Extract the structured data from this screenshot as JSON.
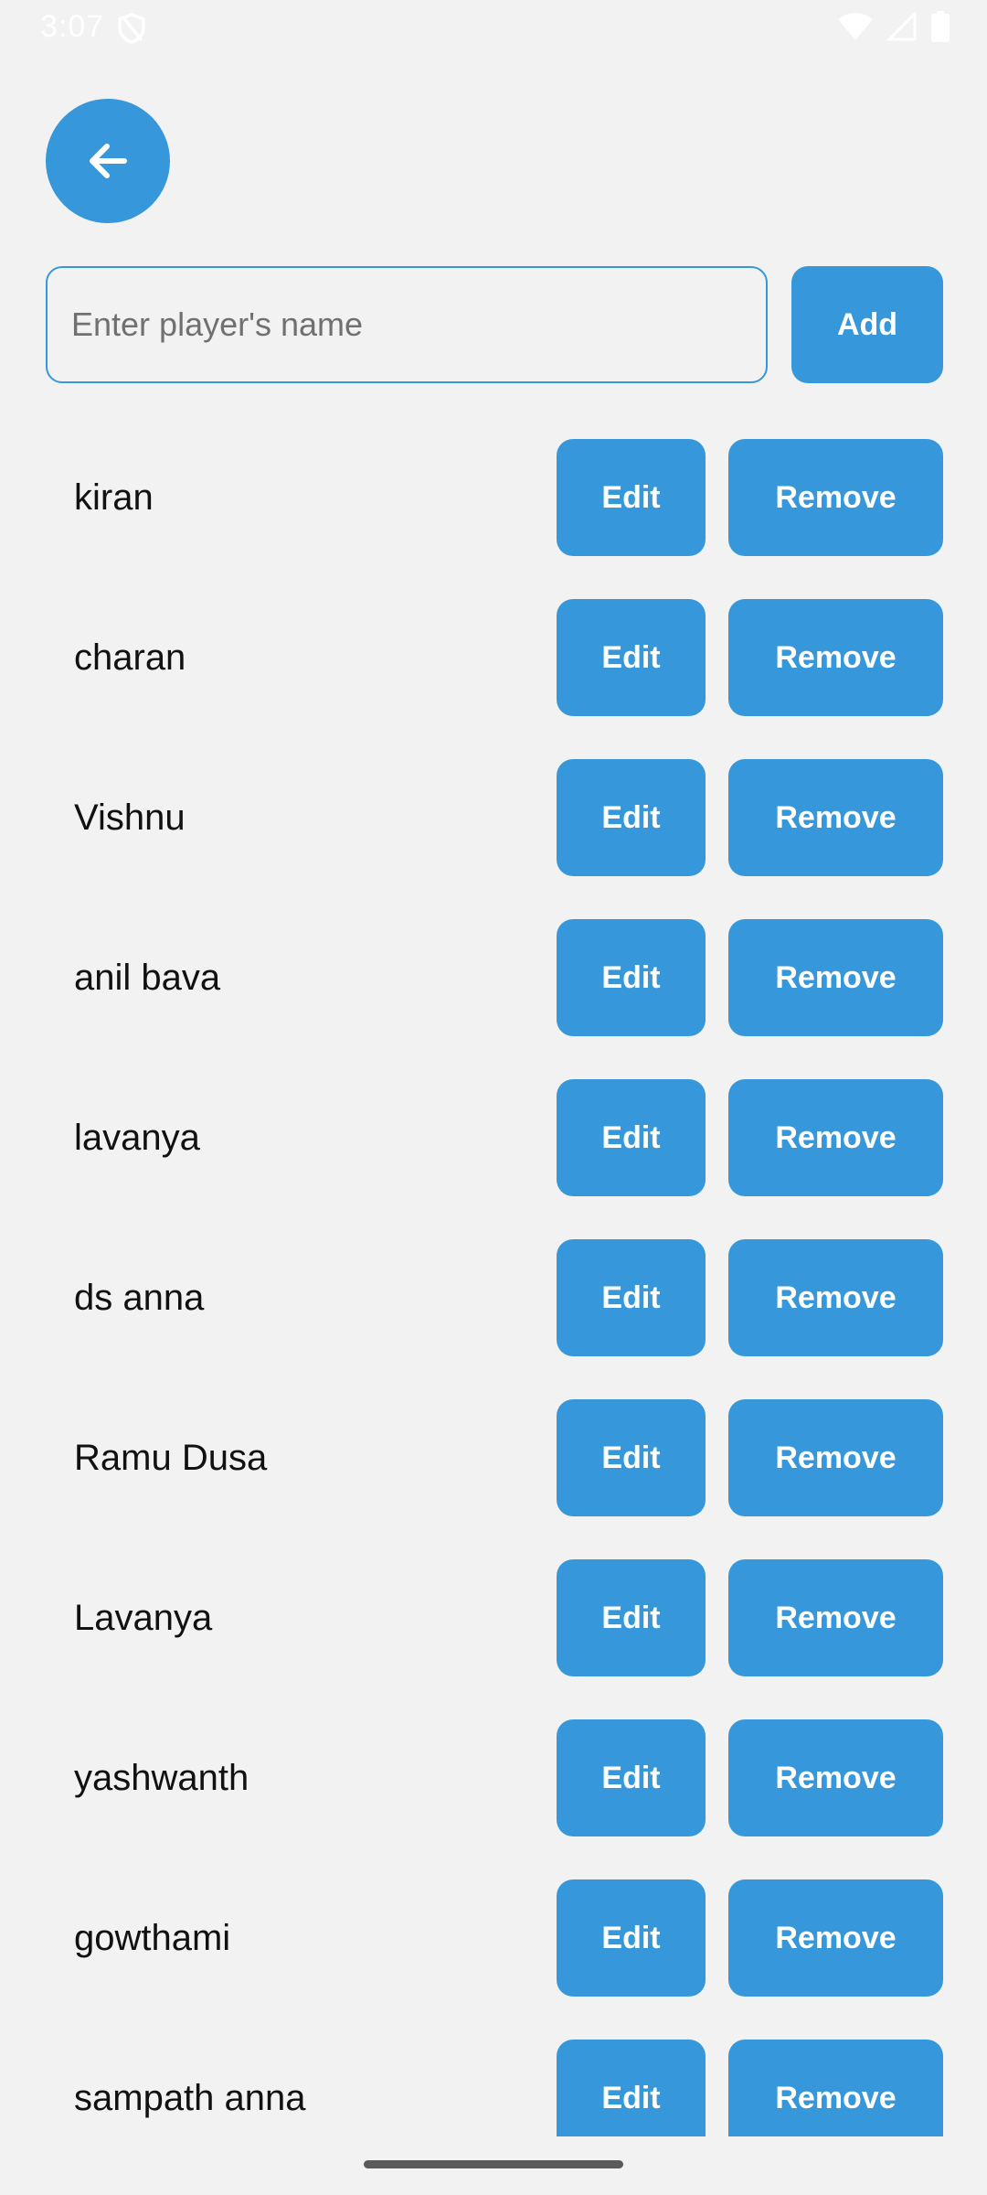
{
  "status_bar": {
    "time": "3:07",
    "icons": [
      "shield-icon",
      "wifi-icon",
      "cellular-icon",
      "battery-icon"
    ]
  },
  "header": {
    "back_icon": "arrow-left-icon"
  },
  "add_player": {
    "value": "",
    "placeholder": "Enter player's name",
    "add_label": "Add"
  },
  "players": [
    {
      "name": "kiran",
      "edit_label": "Edit",
      "remove_label": "Remove"
    },
    {
      "name": "charan",
      "edit_label": "Edit",
      "remove_label": "Remove"
    },
    {
      "name": "Vishnu",
      "edit_label": "Edit",
      "remove_label": "Remove"
    },
    {
      "name": "anil bava",
      "edit_label": "Edit",
      "remove_label": "Remove"
    },
    {
      "name": "lavanya",
      "edit_label": "Edit",
      "remove_label": "Remove"
    },
    {
      "name": "ds anna",
      "edit_label": "Edit",
      "remove_label": "Remove"
    },
    {
      "name": "Ramu Dusa",
      "edit_label": "Edit",
      "remove_label": "Remove"
    },
    {
      "name": "Lavanya",
      "edit_label": "Edit",
      "remove_label": "Remove"
    },
    {
      "name": "yashwanth",
      "edit_label": "Edit",
      "remove_label": "Remove"
    },
    {
      "name": "gowthami",
      "edit_label": "Edit",
      "remove_label": "Remove"
    },
    {
      "name": "sampath anna",
      "edit_label": "Edit",
      "remove_label": "Remove"
    }
  ],
  "colors": {
    "accent": "#3797db",
    "background": "#f2f2f2",
    "text": "#111111"
  }
}
